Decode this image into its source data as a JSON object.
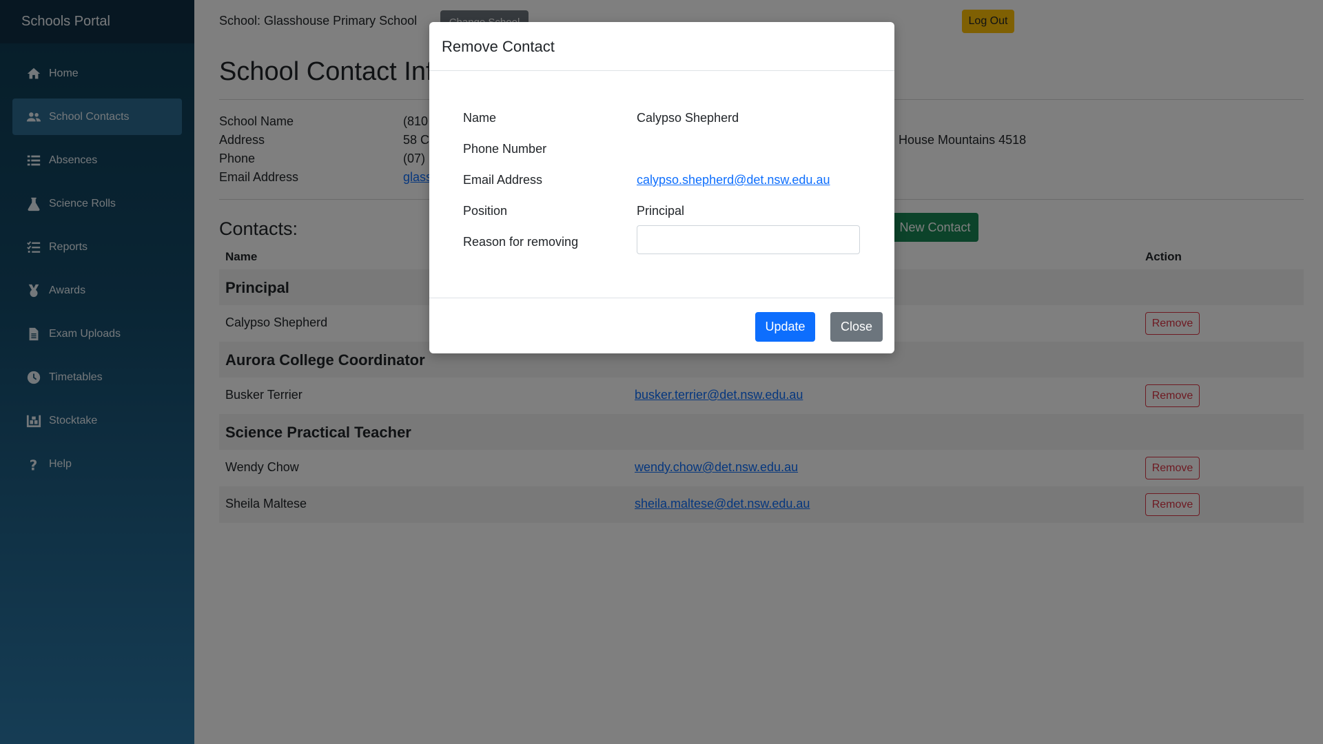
{
  "app": {
    "brand": "Schools Portal"
  },
  "sidebar": {
    "items": [
      {
        "label": "Home",
        "icon": "home-icon",
        "active": false
      },
      {
        "label": "School Contacts",
        "icon": "users-icon",
        "active": true
      },
      {
        "label": "Absences",
        "icon": "list-icon",
        "active": false
      },
      {
        "label": "Science Rolls",
        "icon": "flask-icon",
        "active": false
      },
      {
        "label": "Reports",
        "icon": "tasks-icon",
        "active": false
      },
      {
        "label": "Awards",
        "icon": "medal-icon",
        "active": false
      },
      {
        "label": "Exam Uploads",
        "icon": "file-icon",
        "active": false
      },
      {
        "label": "Timetables",
        "icon": "clock-icon",
        "active": false
      },
      {
        "label": "Stocktake",
        "icon": "warehouse-icon",
        "active": false
      },
      {
        "label": "Help",
        "icon": "question-icon",
        "active": false
      }
    ]
  },
  "topbar": {
    "school_label": "School: Glasshouse Primary School",
    "change_school": "Change School",
    "logout": "Log Out"
  },
  "main": {
    "title": "School Contact Info",
    "school_info": {
      "labels": [
        "School Name",
        "Address",
        "Phone",
        "Email Address"
      ],
      "values": [
        "(810",
        "58 C",
        "(07)",
        "glass"
      ],
      "address_tail": "House Mountains 4518"
    },
    "contacts_title": "Contacts:",
    "new_contact": "New Contact",
    "table": {
      "headers": {
        "name": "Name",
        "action": "Action"
      },
      "groups": [
        {
          "title": "Principal",
          "rows": [
            {
              "name": "Calypso Shepherd",
              "email": ""
            }
          ]
        },
        {
          "title": "Aurora College Coordinator",
          "rows": [
            {
              "name": "Busker Terrier",
              "email": "busker.terrier@det.nsw.edu.au"
            }
          ]
        },
        {
          "title": "Science Practical Teacher",
          "rows": [
            {
              "name": "Wendy Chow",
              "email": "wendy.chow@det.nsw.edu.au"
            },
            {
              "name": "Sheila Maltese",
              "email": "sheila.maltese@det.nsw.edu.au"
            }
          ]
        }
      ],
      "remove_label": "Remove"
    }
  },
  "modal": {
    "title": "Remove Contact",
    "fields": {
      "name_label": "Name",
      "name_value": "Calypso Shepherd",
      "phone_label": "Phone Number",
      "phone_value": "",
      "email_label": "Email Address",
      "email_value": "calypso.shepherd@det.nsw.edu.au",
      "position_label": "Position",
      "position_value": "Principal",
      "reason_label": "Reason for removing",
      "reason_value": ""
    },
    "update": "Update",
    "close": "Close"
  },
  "colors": {
    "sidebar_top": "#0d3b52",
    "sidebar_bottom": "#2c7aaa",
    "primary": "#0d6efd",
    "success": "#198754",
    "warning": "#ffc107",
    "danger": "#dc3545",
    "secondary": "#6c757d"
  }
}
